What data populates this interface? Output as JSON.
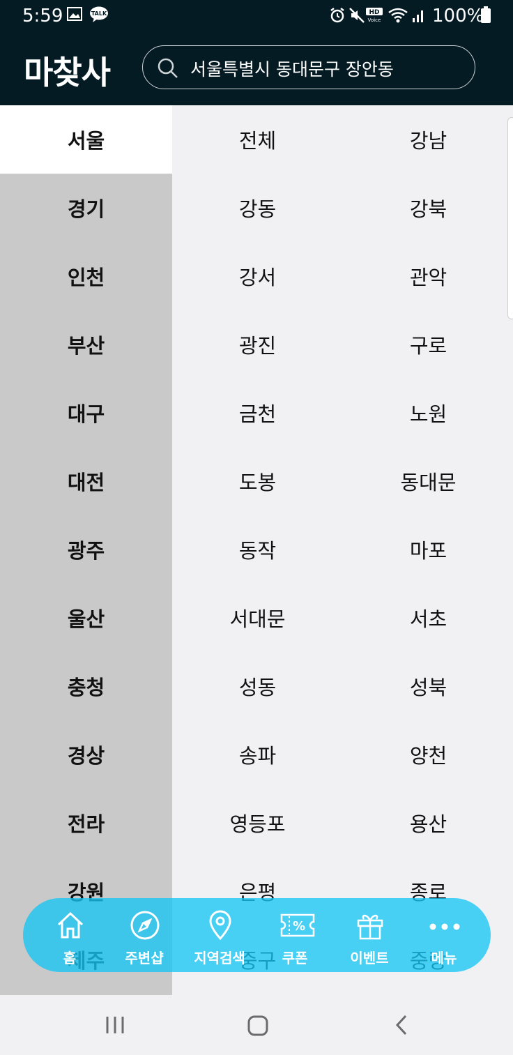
{
  "status_bar": {
    "time": "5:59",
    "battery": "100%",
    "icons": [
      "gallery-icon",
      "kakaotalk-icon",
      "alarm-icon",
      "mute-icon",
      "hd-voice-icon",
      "wifi-icon",
      "signal-icon",
      "battery-icon"
    ],
    "talk_badge": "TALK",
    "hd_badge": "HD",
    "voice_badge": "Voice"
  },
  "header": {
    "logo": "마찾사",
    "search_value": "서울특별시 동대문구 장안동"
  },
  "regions": [
    "서울",
    "경기",
    "인천",
    "부산",
    "대구",
    "대전",
    "광주",
    "울산",
    "충청",
    "경상",
    "전라",
    "강원",
    "제주"
  ],
  "selected_region": "서울",
  "districts": [
    "전체",
    "강남",
    "강동",
    "강북",
    "강서",
    "관악",
    "광진",
    "구로",
    "금천",
    "노원",
    "도봉",
    "동대문",
    "동작",
    "마포",
    "서대문",
    "서초",
    "성동",
    "성북",
    "송파",
    "양천",
    "영등포",
    "용산",
    "은평",
    "종로",
    "중구",
    "중랑"
  ],
  "bottom_nav": [
    {
      "label": "홈",
      "icon": "home-icon"
    },
    {
      "label": "주변샵",
      "icon": "compass-icon"
    },
    {
      "label": "지역검색",
      "icon": "location-pin-icon"
    },
    {
      "label": "쿠폰",
      "icon": "coupon-icon"
    },
    {
      "label": "이벤트",
      "icon": "gift-icon"
    },
    {
      "label": "메뉴",
      "icon": "more-icon"
    }
  ],
  "colors": {
    "header_bg": "#041b24",
    "nav_bg": "#17c5f3",
    "left_bg": "#c9c9c9",
    "right_bg": "#f1f1f3"
  }
}
